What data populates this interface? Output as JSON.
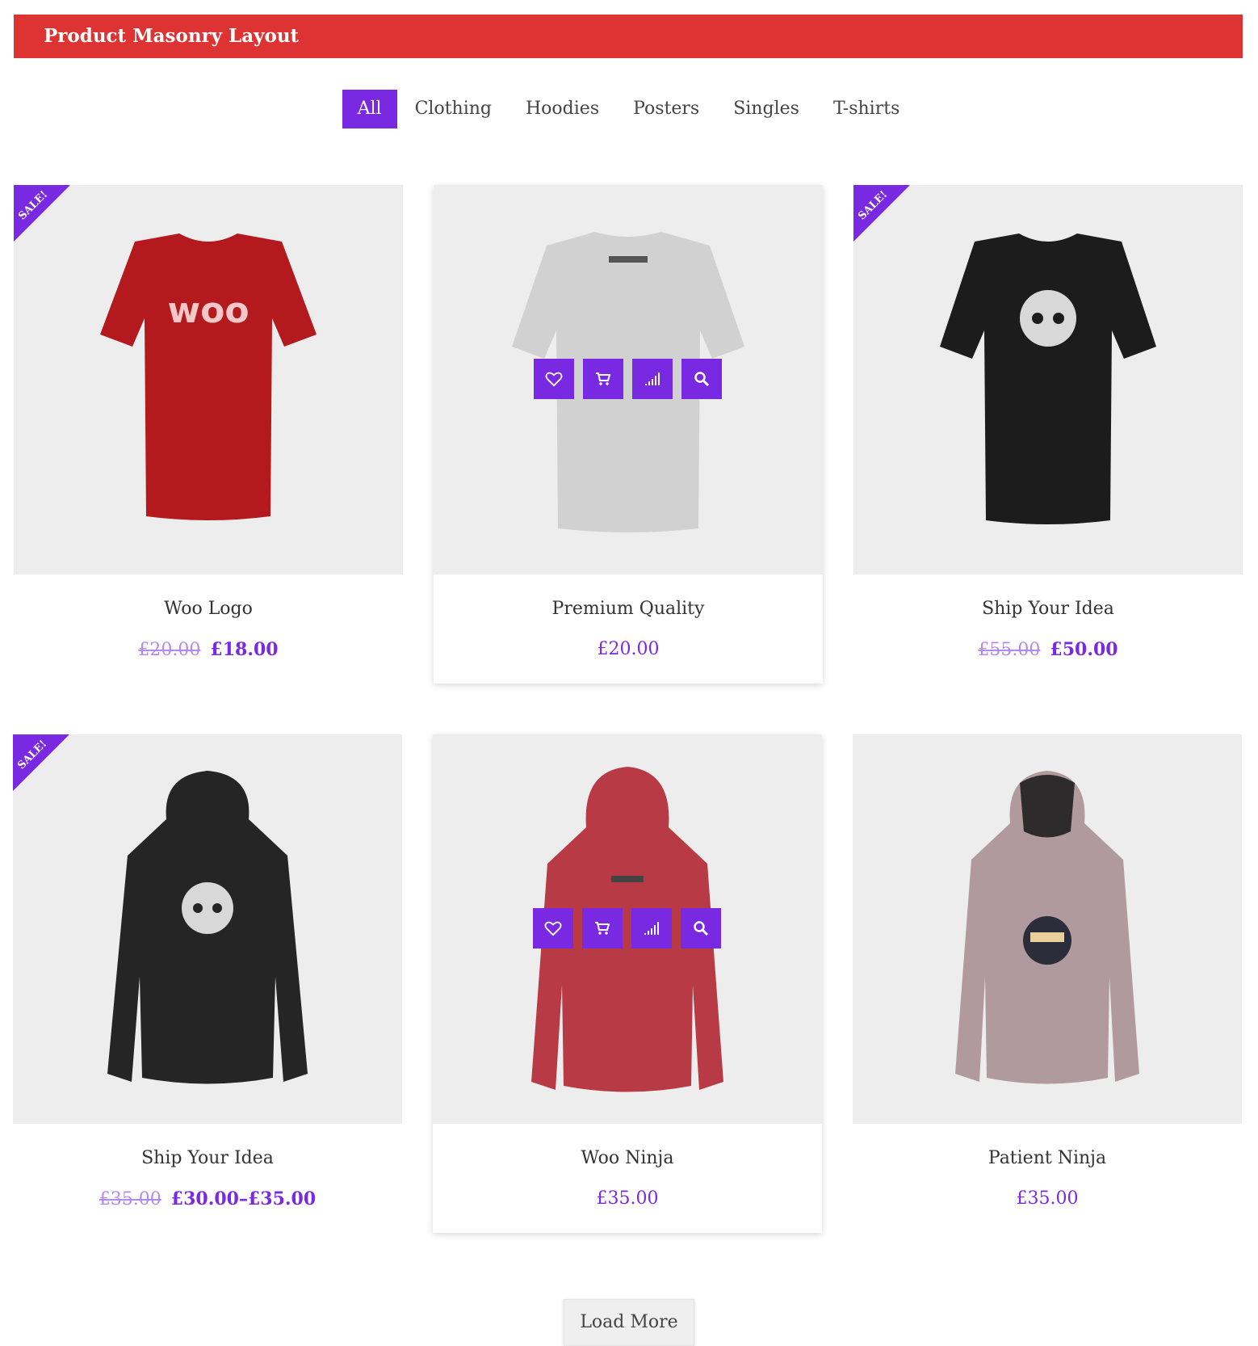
{
  "header": {
    "title": "Product Masonry Layout"
  },
  "filters": [
    "All",
    "Clothing",
    "Hoodies",
    "Posters",
    "Singles",
    "T-shirts"
  ],
  "sale_label": "SALE!",
  "products": [
    {
      "title": "Woo Logo",
      "old_price": "£20.00",
      "price": "£18.00",
      "sale": true,
      "image": "red-tshirt-woo"
    },
    {
      "title": "Premium Quality",
      "old_price": "",
      "price": "£20.00",
      "sale": false,
      "image": "grey-tshirt-back"
    },
    {
      "title": "Ship Your Idea",
      "old_price": "£55.00",
      "price": "£50.00",
      "sale": true,
      "image": "black-tshirt-skull"
    },
    {
      "title": "Ship Your Idea",
      "old_price": "£35.00",
      "price": "£30.00–£35.00",
      "sale": true,
      "image": "black-hoodie-skull"
    },
    {
      "title": "Woo Ninja",
      "old_price": "",
      "price": "£35.00",
      "sale": false,
      "image": "red-hoodie-back"
    },
    {
      "title": "Patient Ninja",
      "old_price": "",
      "price": "£35.00",
      "sale": false,
      "image": "pink-hoodie-ninja"
    }
  ],
  "actions": [
    "heart-icon",
    "cart-icon",
    "compare-icon",
    "search-icon"
  ],
  "load_more": "Load More",
  "colors": {
    "header": "#de3333",
    "accent": "#7a29e3"
  }
}
